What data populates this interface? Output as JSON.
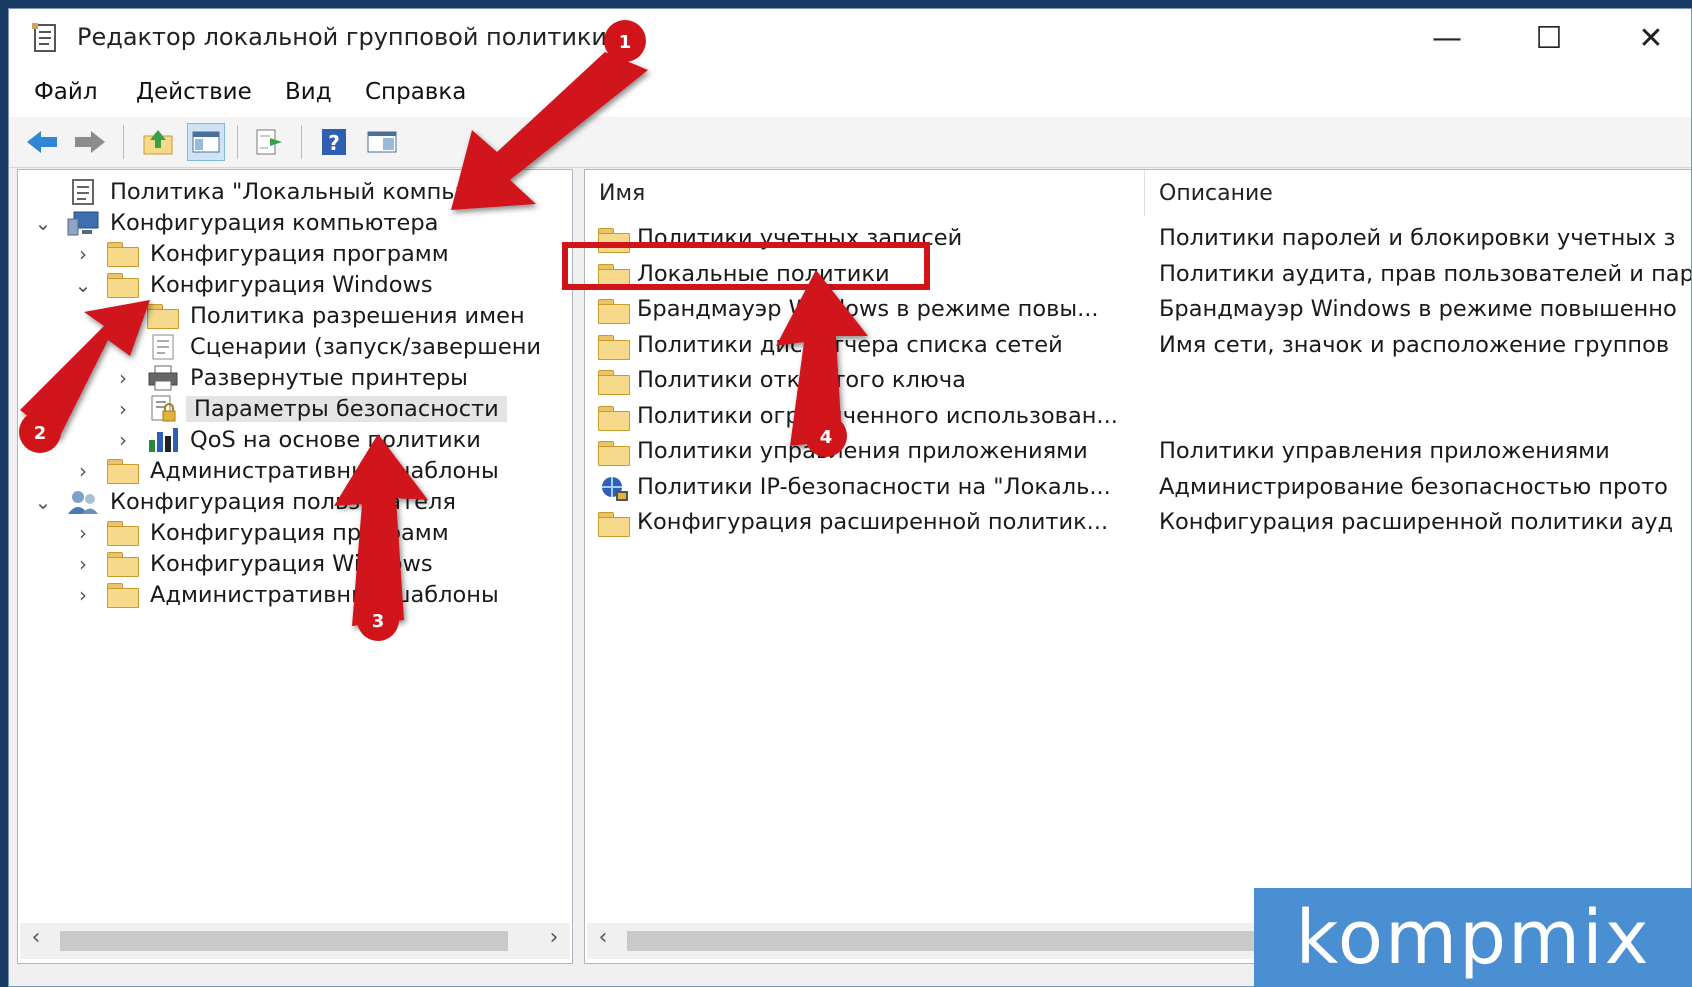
{
  "window": {
    "title": "Редактор локальной групповой политики",
    "minimize_icon": "—",
    "maximize_icon": "☐",
    "close_icon": "✕"
  },
  "menu": [
    "Файл",
    "Действие",
    "Вид",
    "Справка"
  ],
  "tree": [
    {
      "label": "Политика \"Локальный компью",
      "level": 0,
      "chevron": "",
      "icon": "policy-icon"
    },
    {
      "label": "Конфигурация компьютера",
      "level": 0,
      "chevron": "⌄",
      "icon": "computer-icon"
    },
    {
      "label": "Конфигурация программ",
      "level": 1,
      "chevron": "›",
      "icon": "folder-icon"
    },
    {
      "label": "Конфигурация Windows",
      "level": 1,
      "chevron": "⌄",
      "icon": "folder-icon"
    },
    {
      "label": "Политика разрешения имен",
      "level": 2,
      "chevron": "",
      "icon": "folder-icon"
    },
    {
      "label": "Сценарии (запуск/завершени",
      "level": 2,
      "chevron": "",
      "icon": "script-icon"
    },
    {
      "label": "Развернутые принтеры",
      "level": 2,
      "chevron": "›",
      "icon": "printer-icon"
    },
    {
      "label": "Параметры безопасности",
      "level": 2,
      "chevron": "›",
      "icon": "security-icon",
      "selected": true
    },
    {
      "label": "QoS на основе политики",
      "level": 2,
      "chevron": "›",
      "icon": "chart-icon"
    },
    {
      "label": "Административные шаблоны",
      "level": 1,
      "chevron": "›",
      "icon": "folder-icon"
    },
    {
      "label": "Конфигурация пользователя",
      "level": 0,
      "chevron": "⌄",
      "icon": "user-icon"
    },
    {
      "label": "Конфигурация программ",
      "level": 1,
      "chevron": "›",
      "icon": "folder-icon"
    },
    {
      "label": "Конфигурация Windows",
      "level": 1,
      "chevron": "›",
      "icon": "folder-icon"
    },
    {
      "label": "Административные шаблоны",
      "level": 1,
      "chevron": "›",
      "icon": "folder-icon"
    }
  ],
  "list": {
    "columns": [
      "Имя",
      "Описание"
    ],
    "rows": [
      {
        "name": "Политики учетных записей",
        "desc": "Политики паролей и блокировки учетных з",
        "icon": "folder-icon"
      },
      {
        "name": "Локальные политики",
        "desc": "Политики аудита, прав пользователей и пар",
        "icon": "folder-icon"
      },
      {
        "name": "Брандмауэр Windows в режиме повы...",
        "desc": "Брандмауэр Windows в режиме повышенно",
        "icon": "folder-icon"
      },
      {
        "name": "Политики диспетчера списка сетей",
        "desc": "Имя сети, значок и расположение группов",
        "icon": "folder-icon"
      },
      {
        "name": "Политики открытого ключа",
        "desc": "",
        "icon": "folder-icon"
      },
      {
        "name": "Политики ограниченного использован...",
        "desc": "",
        "icon": "folder-icon"
      },
      {
        "name": "Политики управления приложениями",
        "desc": "Политики управления приложениями",
        "icon": "folder-icon"
      },
      {
        "name": "Политики IP-безопасности на \"Локаль...",
        "desc": "Администрирование безопасностью прото",
        "icon": "ipsec-icon"
      },
      {
        "name": "Конфигурация расширенной политик...",
        "desc": "Конфигурация расширенной политики ауд",
        "icon": "folder-icon"
      }
    ]
  },
  "scroll": {
    "left_arrow": "‹",
    "right_arrow": "›"
  },
  "annotations": {
    "badges": [
      "1",
      "2",
      "3",
      "4"
    ],
    "color": "#d0141a"
  },
  "watermark": "kompmix"
}
